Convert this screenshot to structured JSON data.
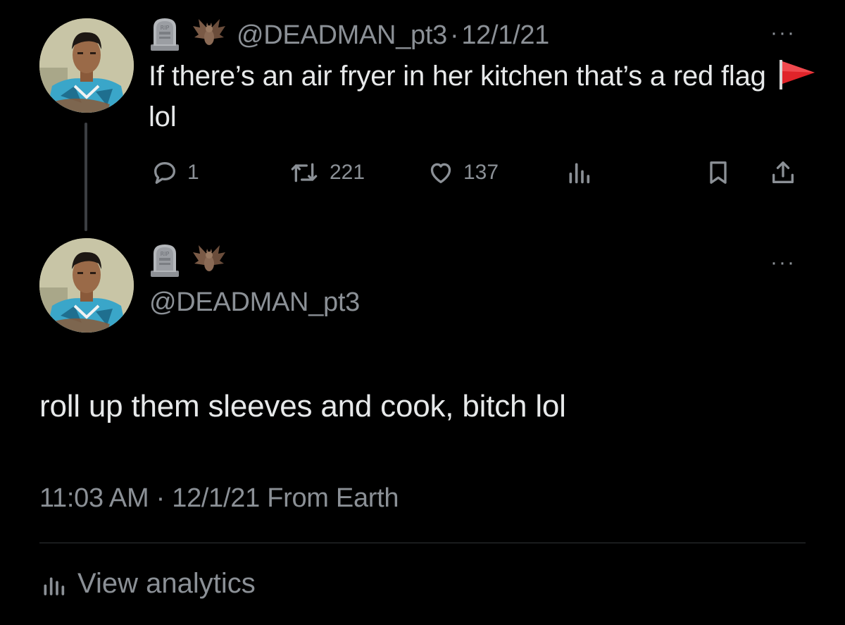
{
  "parent_tweet": {
    "author_emojis": [
      "headstone",
      "bat"
    ],
    "handle": "@DEADMAN_pt3",
    "separator": "·",
    "date": "12/1/21",
    "text_before_flag": "If there’s an air fryer in her kitchen that’s a red flag",
    "text_after_flag": "lol",
    "counts": {
      "replies": "1",
      "retweets": "221",
      "likes": "137"
    }
  },
  "reply_tweet": {
    "author_emojis": [
      "headstone",
      "bat"
    ],
    "handle": "@DEADMAN_pt3",
    "text": "roll up them sleeves and cook, bitch lol",
    "time": "11:03 AM",
    "separator": "·",
    "date": "12/1/21",
    "source": "From Earth",
    "view_analytics": "View analytics"
  },
  "more_menu": "···",
  "colors": {
    "background": "#000000",
    "text": "#e7e9ea",
    "muted": "#8b9096",
    "divider": "#2f3336",
    "flag_red": "#e0242a"
  },
  "icons": [
    "reply-icon",
    "retweet-icon",
    "like-icon",
    "views-icon",
    "bookmark-icon",
    "share-icon",
    "analytics-icon",
    "headstone-emoji",
    "bat-emoji",
    "red-flag-emoji"
  ]
}
